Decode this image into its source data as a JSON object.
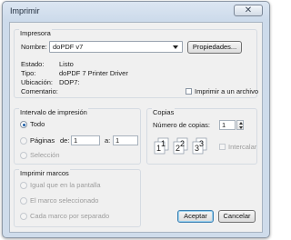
{
  "window": {
    "title": "Imprimir",
    "close_glyph": "✕"
  },
  "printer": {
    "group_label": "Impresora",
    "name_label": "Nombre:",
    "name_value": "doPDF v7",
    "properties_button": "Propiedades...",
    "status_label": "Estado:",
    "status_value": "Listo",
    "type_label": "Tipo:",
    "type_value": "doPDF 7 Printer Driver",
    "location_label": "Ubicación:",
    "location_value": "DOP7:",
    "comment_label": "Comentario:",
    "print_to_file_label": "Imprimir a un archivo"
  },
  "print_range": {
    "group_label": "Intervalo de impresión",
    "all_label": "Todo",
    "pages_label": "Páginas",
    "from_label": "de:",
    "from_value": "1",
    "to_label": "a:",
    "to_value": "1",
    "selection_label": "Selección"
  },
  "copies": {
    "group_label": "Copias",
    "count_label": "Número de copias:",
    "count_value": "1",
    "collate_label": "Intercalar",
    "collate_glyphs": [
      "1",
      "1",
      "2",
      "2",
      "3",
      "3"
    ]
  },
  "frames": {
    "group_label": "Imprimir marcos",
    "options": [
      "Igual que en la pantalla",
      "El marco seleccionado",
      "Cada marco por separado"
    ]
  },
  "buttons": {
    "ok": "Aceptar",
    "cancel": "Cancelar"
  }
}
